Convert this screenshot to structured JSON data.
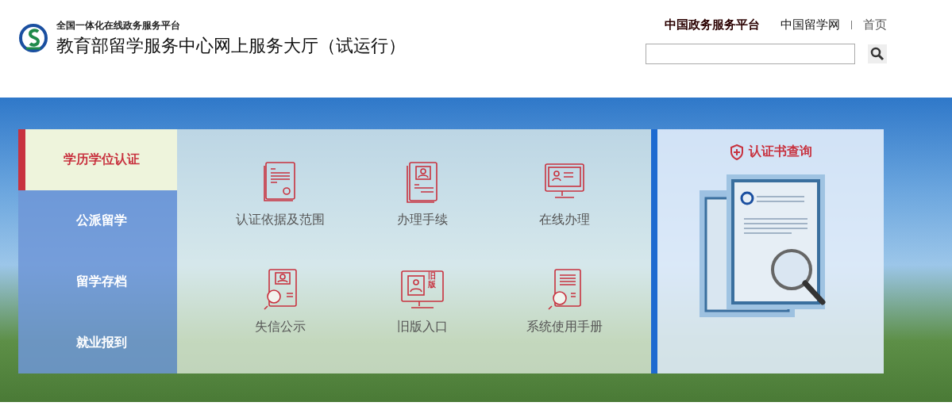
{
  "header": {
    "platform_label": "全国一体化在线政务服务平台",
    "title": "教育部留学服务中心网上服务大厅（试运行）"
  },
  "nav": [
    {
      "label": "中国政务服务平台",
      "kind": "strong"
    },
    {
      "label": "中国留学网",
      "kind": "plain"
    },
    {
      "label": "首页",
      "kind": "muted"
    }
  ],
  "sidebar": [
    {
      "label": "学历学位认证",
      "selected": true
    },
    {
      "label": "公派留学",
      "selected": false
    },
    {
      "label": "留学存档",
      "selected": false
    },
    {
      "label": "就业报到",
      "selected": false
    }
  ],
  "services": [
    {
      "label": "认证依据及范围",
      "kind": "certificate"
    },
    {
      "label": "办理手续",
      "kind": "profile"
    },
    {
      "label": "在线办理",
      "kind": "monitor"
    },
    {
      "label": "失信公示",
      "kind": "inspect"
    },
    {
      "label": "旧版入口",
      "kind": "legacy",
      "icon_text": "旧版"
    },
    {
      "label": "系统使用手册",
      "kind": "manual"
    }
  ],
  "cert_query": {
    "title": "认证书查询"
  }
}
